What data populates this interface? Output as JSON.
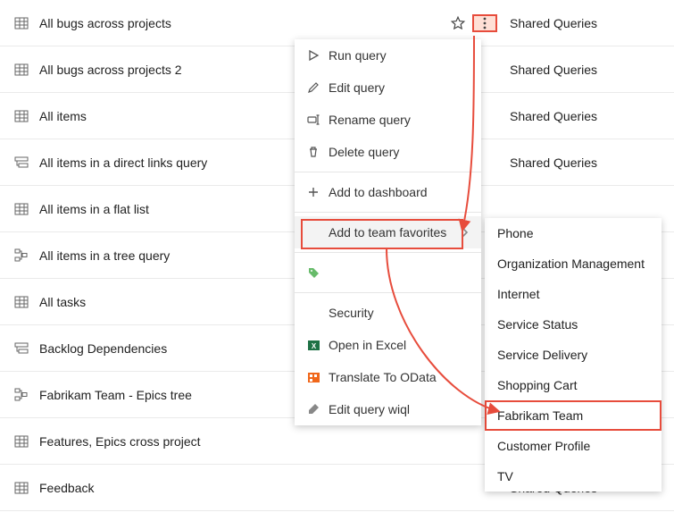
{
  "rows": [
    {
      "name": "All bugs across projects",
      "folder": "Shared Queries",
      "kind": "flat",
      "star": true,
      "more": true
    },
    {
      "name": "All bugs across projects 2",
      "folder": "Shared Queries",
      "kind": "flat"
    },
    {
      "name": "All items",
      "folder": "Shared Queries",
      "kind": "flat"
    },
    {
      "name": "All items in a direct links query",
      "folder": "Shared Queries",
      "kind": "direct"
    },
    {
      "name": "All items in a flat list",
      "folder": "",
      "kind": "flat"
    },
    {
      "name": "All items in a tree query",
      "folder": "",
      "kind": "tree"
    },
    {
      "name": "All tasks",
      "folder": "",
      "kind": "flat"
    },
    {
      "name": "Backlog Dependencies",
      "folder": "",
      "kind": "direct"
    },
    {
      "name": "Fabrikam Team - Epics tree",
      "folder": "",
      "kind": "tree"
    },
    {
      "name": "Features, Epics cross project",
      "folder": "",
      "kind": "flat"
    },
    {
      "name": "Feedback",
      "folder": "Shared Queries",
      "kind": "flat"
    }
  ],
  "ctx": {
    "run": "Run query",
    "edit": "Edit query",
    "rename": "Rename query",
    "delete": "Delete query",
    "addDash": "Add to dashboard",
    "addFav": "Add to team favorites",
    "tag": "",
    "security": "Security",
    "excel": "Open in Excel",
    "odata": "Translate To OData",
    "wiql": "Edit query wiql"
  },
  "sub": [
    "Phone",
    "Organization Management",
    "Internet",
    "Service Status",
    "Service Delivery",
    "Shopping Cart",
    "Fabrikam Team",
    "Customer Profile",
    "TV"
  ],
  "subHighlightIndex": 6
}
